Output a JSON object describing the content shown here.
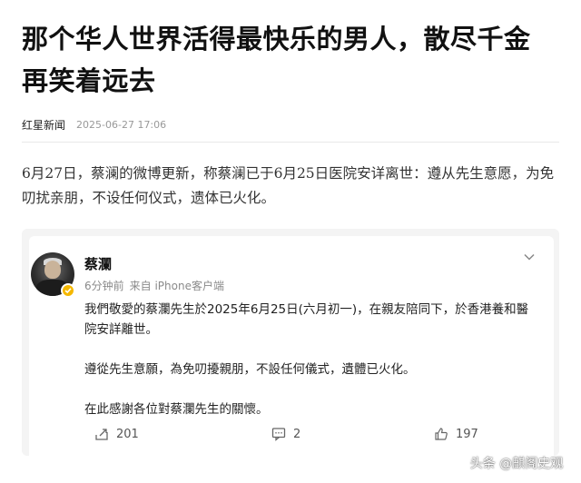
{
  "article": {
    "title_line1": "那个华人世界活得最快乐的男人，散尽千金",
    "title_line2": "再笑着远去",
    "source": "红星新闻",
    "date": "2025-06-27 17:06",
    "paragraph": "6月27日，蔡澜的微博更新，称蔡澜已于6月25日医院安详离世：遵从先生意愿，为免叨扰亲朋，不设任何仪式，遗体已火化。"
  },
  "weibo_card": {
    "author": "蔡瀾",
    "time": "6分钟前",
    "via": "来自 iPhone客户端",
    "post_line1": "我們敬愛的蔡瀾先生於2025年6月25日(六月初一)，在親友陪同下，於香港養和醫",
    "post_line2": "院安詳離世。",
    "post_line3": "遵從先生意願，為免叨擾親朋，不設任何儀式，遺體已火化。",
    "post_line4": "在此感謝各位對蔡瀾先生的關懷。",
    "reposts": "201",
    "comments": "2",
    "likes": "197"
  },
  "watermark": {
    "text": "头条 @麒阁史观"
  },
  "colors": {
    "verified_badge": "#f5b800",
    "card_bg": "#f4f4f4"
  },
  "icons": {
    "repost": "repost-icon",
    "comment": "comment-icon",
    "like": "thumbs-up-icon",
    "more": "chevron-down-icon",
    "verified": "verified-badge-icon"
  }
}
